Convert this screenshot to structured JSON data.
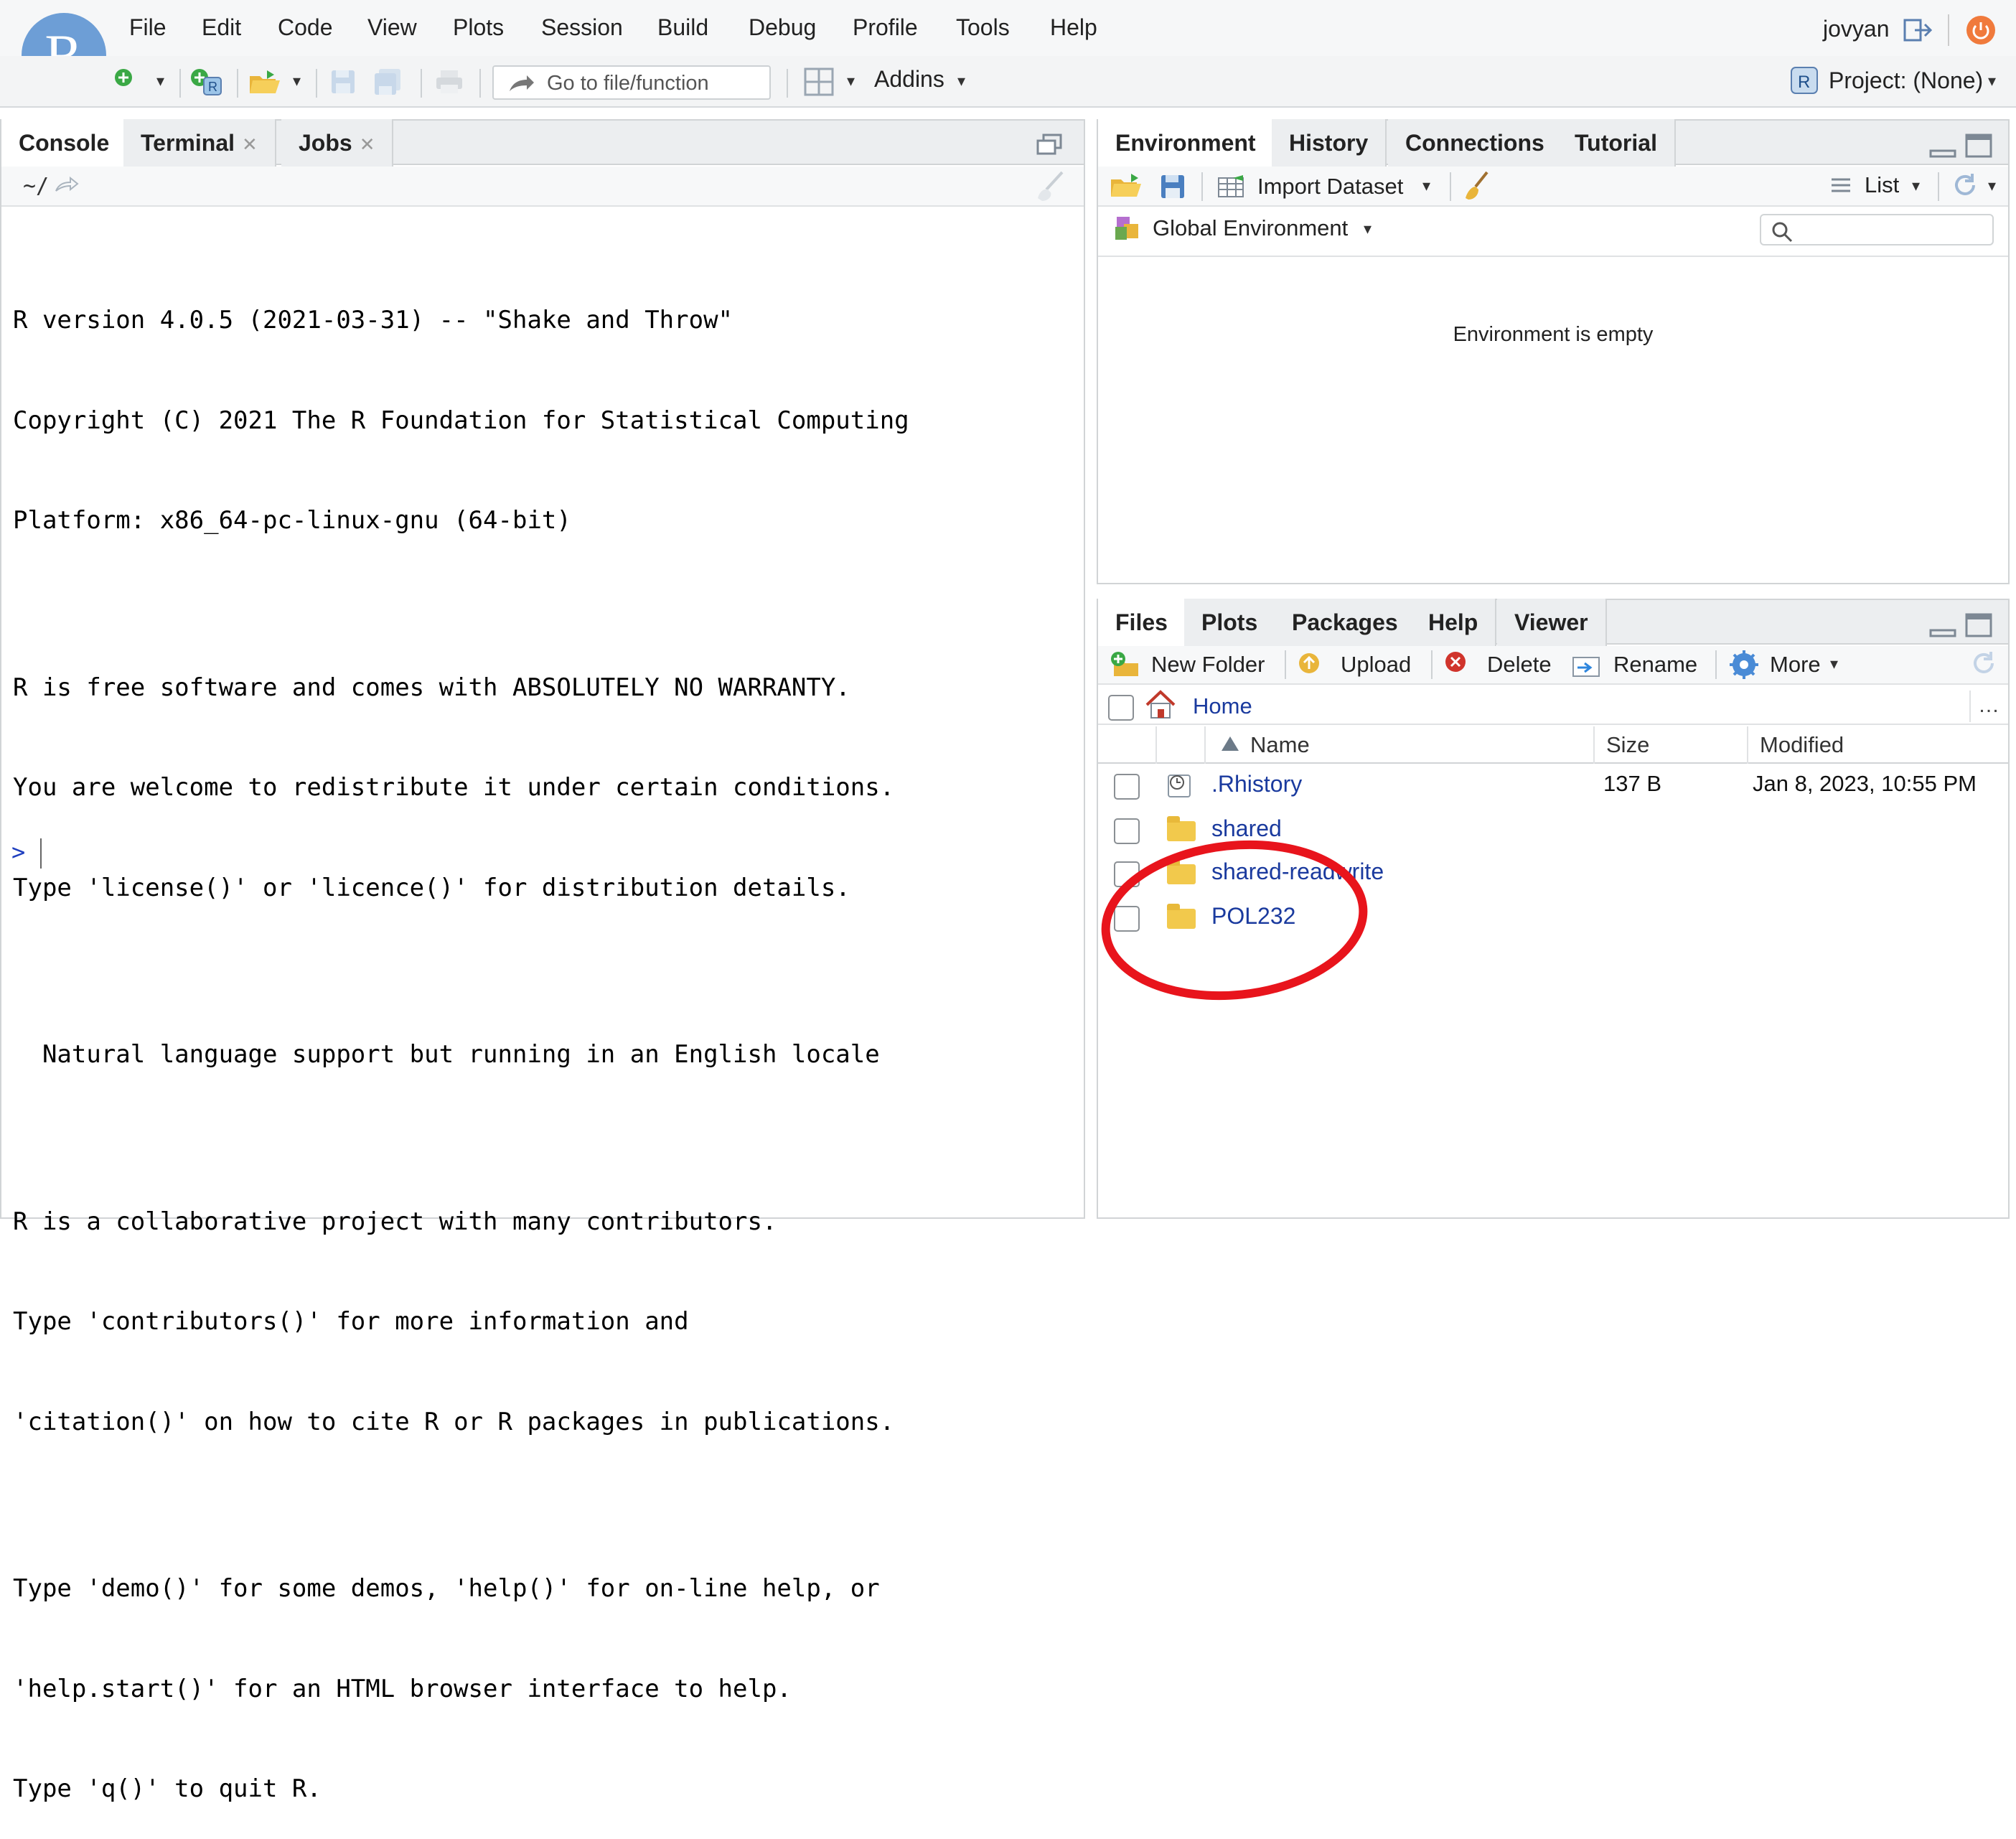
{
  "app": {
    "logo_letter": "R",
    "user": "jovyan",
    "project_label": "Project: (None)"
  },
  "menu": [
    "File",
    "Edit",
    "Code",
    "View",
    "Plots",
    "Session",
    "Build",
    "Debug",
    "Profile",
    "Tools",
    "Help"
  ],
  "toolbar": {
    "goto_placeholder": "Go to file/function",
    "addins_label": "Addins"
  },
  "left_pane": {
    "tabs": [
      {
        "label": "Console"
      },
      {
        "label": "Terminal"
      },
      {
        "label": "Jobs"
      }
    ],
    "path": "~/",
    "console_lines": [
      "R version 4.0.5 (2021-03-31) -- \"Shake and Throw\"",
      "Copyright (C) 2021 The R Foundation for Statistical Computing",
      "Platform: x86_64-pc-linux-gnu (64-bit)",
      "",
      "R is free software and comes with ABSOLUTELY NO WARRANTY.",
      "You are welcome to redistribute it under certain conditions.",
      "Type 'license()' or 'licence()' for distribution details.",
      "",
      "  Natural language support but running in an English locale",
      "",
      "R is a collaborative project with many contributors.",
      "Type 'contributors()' for more information and",
      "'citation()' on how to cite R or R packages in publications.",
      "",
      "Type 'demo()' for some demos, 'help()' for on-line help, or",
      "'help.start()' for an HTML browser interface to help.",
      "Type 'q()' to quit R."
    ],
    "prompt": ">"
  },
  "env_pane": {
    "tabs": [
      {
        "label": "Environment"
      },
      {
        "label": "History"
      },
      {
        "label": "Connections"
      },
      {
        "label": "Tutorial"
      }
    ],
    "import_label": "Import Dataset",
    "view_mode": "List",
    "scope_label": "Global Environment",
    "empty_message": "Environment is empty"
  },
  "files_pane": {
    "tabs": [
      {
        "label": "Files"
      },
      {
        "label": "Plots"
      },
      {
        "label": "Packages"
      },
      {
        "label": "Help"
      },
      {
        "label": "Viewer"
      }
    ],
    "actions": {
      "new_folder": "New Folder",
      "upload": "Upload",
      "delete": "Delete",
      "rename": "Rename",
      "more": "More"
    },
    "breadcrumb_home": "Home",
    "columns": {
      "name": "Name",
      "size": "Size",
      "modified": "Modified"
    },
    "rows": [
      {
        "name": ".Rhistory",
        "size": "137 B",
        "modified": "Jan 8, 2023, 10:55 PM"
      },
      {
        "name": "shared",
        "size": "",
        "modified": ""
      },
      {
        "name": "shared-readwrite",
        "size": "",
        "modified": ""
      },
      {
        "name": "POL232",
        "size": "",
        "modified": ""
      }
    ],
    "annotation_color": "#e8141c"
  }
}
